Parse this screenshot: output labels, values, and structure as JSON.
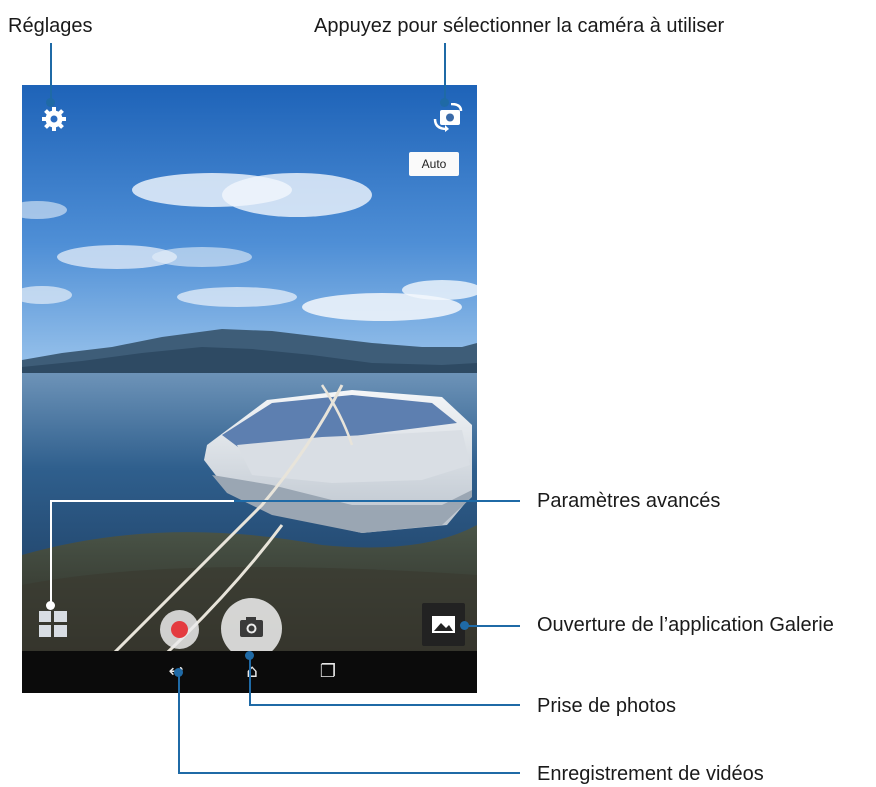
{
  "callouts": {
    "settings": "Réglages",
    "camera_select": "Appuyez pour sélectionner la caméra à utiliser",
    "advanced": "Paramètres avancés",
    "gallery": "Ouverture de l’application Galerie",
    "photo": "Prise de photos",
    "video": "Enregistrement de vidéos"
  },
  "screen": {
    "auto_label": "Auto",
    "icons": {
      "settings": "gear-icon",
      "switch_camera": "switch-camera-icon",
      "advanced": "grid-icon",
      "record": "record-icon",
      "shutter": "camera-icon",
      "gallery": "image-icon",
      "back": "back-icon",
      "home": "home-icon",
      "recents": "recents-icon"
    }
  },
  "colors": {
    "callout_line": "#1f6aa6",
    "record_red": "#e43b3f",
    "navbar": "#0b0b0b"
  }
}
